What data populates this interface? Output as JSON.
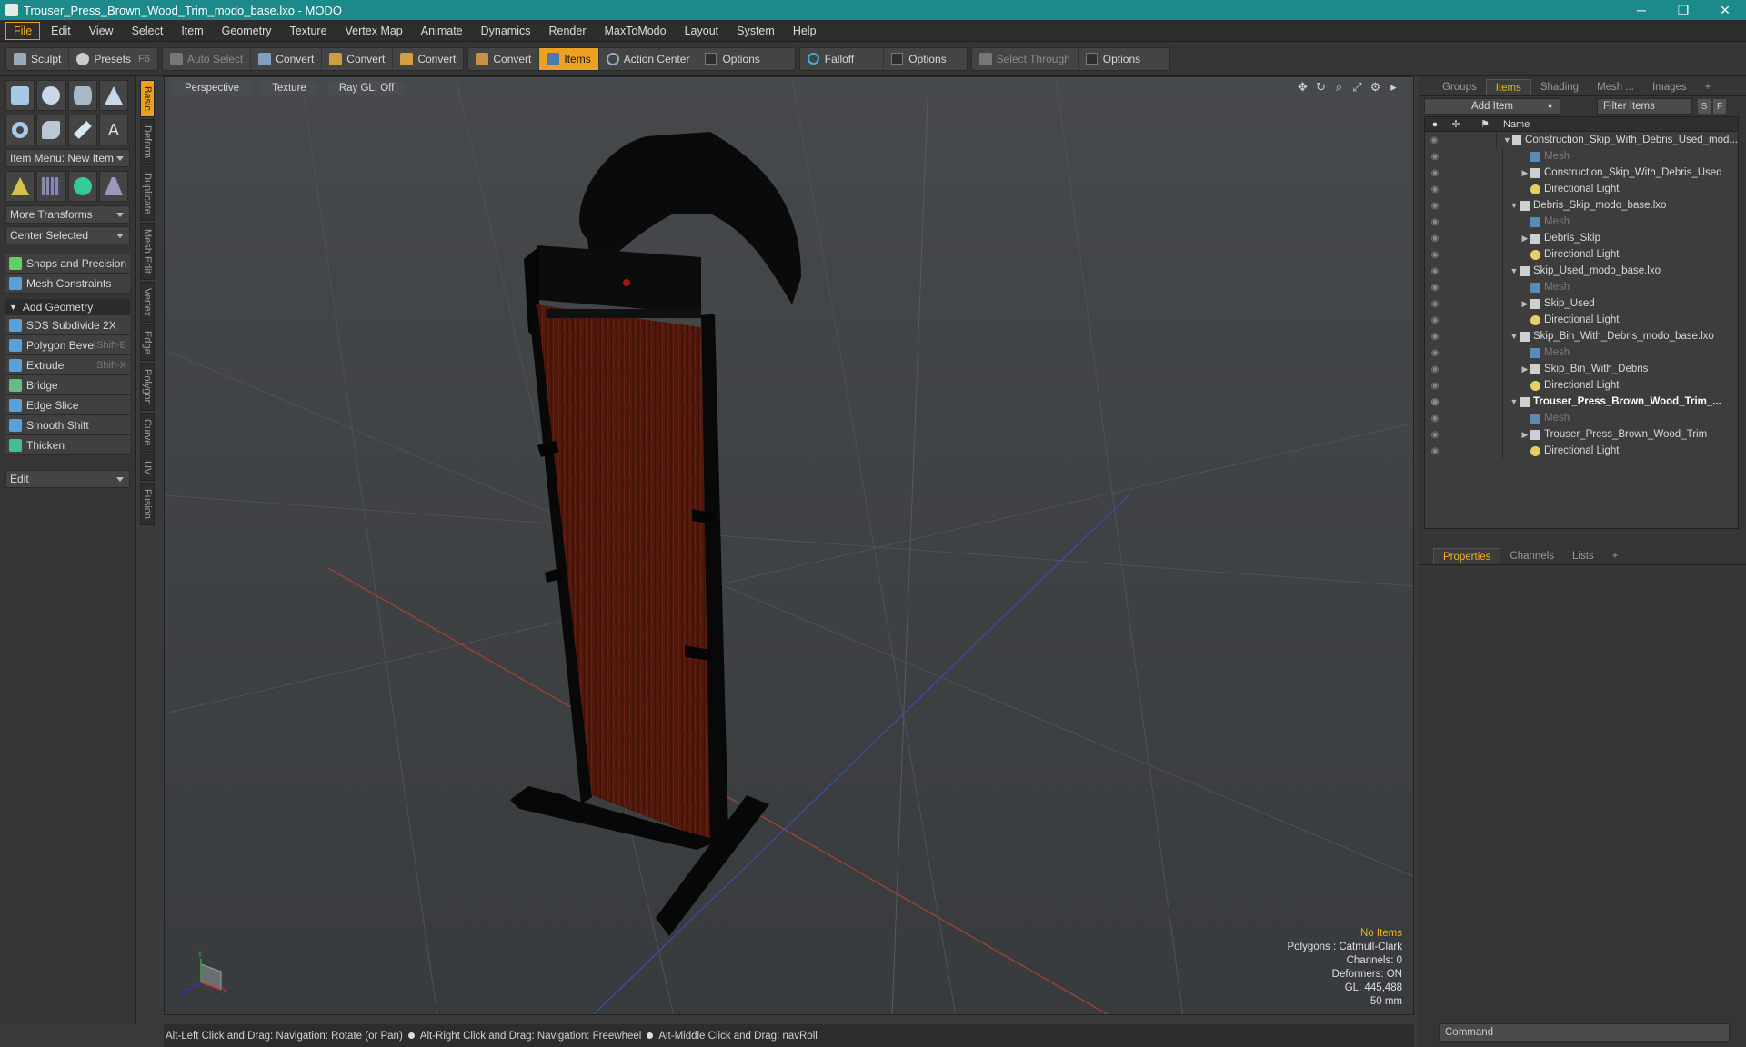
{
  "window": {
    "title": "Trouser_Press_Brown_Wood_Trim_modo_base.lxo - MODO",
    "min_glyph": "─",
    "restore_glyph": "❐",
    "close_glyph": "✕"
  },
  "menu": [
    "File",
    "Edit",
    "View",
    "Select",
    "Item",
    "Geometry",
    "Texture",
    "Vertex Map",
    "Animate",
    "Dynamics",
    "Render",
    "MaxToModo",
    "Layout",
    "System",
    "Help"
  ],
  "toolbar": {
    "sculpt": "Sculpt",
    "presets": "Presets",
    "presets_key": "F6",
    "auto_select": "Auto Select",
    "convert": "Convert",
    "items": "Items",
    "action_center": "Action Center",
    "options": "Options",
    "falloff": "Falloff",
    "select_through": "Select Through"
  },
  "left_panel": {
    "item_menu": "Item Menu: New Item",
    "more_transforms": "More Transforms",
    "center_selected": "Center Selected",
    "snaps": "Snaps and Precision",
    "mesh_constraints": "Mesh Constraints",
    "add_geometry": "Add Geometry",
    "tools": [
      {
        "label": "SDS Subdivide 2X",
        "short": ""
      },
      {
        "label": "Polygon Bevel",
        "short": "Shift-B"
      },
      {
        "label": "Extrude",
        "short": "Shift-X"
      },
      {
        "label": "Bridge",
        "short": ""
      },
      {
        "label": "Edge Slice",
        "short": ""
      },
      {
        "label": "Smooth Shift",
        "short": ""
      },
      {
        "label": "Thicken",
        "short": ""
      }
    ],
    "edit": "Edit",
    "vtabs": [
      "Basic",
      "Deform",
      "Duplicate",
      "Mesh Edit",
      "Vertex",
      "Edge",
      "Polygon",
      "Curve",
      "UV",
      "Fusion"
    ]
  },
  "viewport": {
    "tabs": [
      "Perspective",
      "Texture",
      "Ray GL: Off"
    ],
    "info": {
      "no_items": "No Items",
      "polygons": "Polygons : Catmull-Clark",
      "channels": "Channels: 0",
      "deformers": "Deformers: ON",
      "gl": "GL: 445,488",
      "lens": "50 mm"
    },
    "axis": {
      "x": "X",
      "y": "Y",
      "z": "Z"
    },
    "colors": {
      "wood": "#5a1a10",
      "frame": "#0a0a0a",
      "grid": "#555a5e",
      "x_axis": "#c0392b",
      "z_axis": "#3a4fb0"
    }
  },
  "status": {
    "hint1": "Alt-Left Click and Drag: Navigation: Rotate (or Pan)",
    "hint2": "Alt-Right Click and Drag: Navigation: Freewheel",
    "hint3": "Alt-Middle Click and Drag: navRoll"
  },
  "right_panel": {
    "tabs": [
      "Groups",
      "Items",
      "Shading",
      "Mesh ...",
      "Images"
    ],
    "add_item": "Add Item",
    "filter_items": "Filter Items",
    "s_btn": "S",
    "f_btn": "F",
    "col_name": "Name",
    "tree": [
      {
        "label": "Construction_Skip_With_Debris_Used_mod...",
        "level": 0,
        "type": "scene"
      },
      {
        "label": "Mesh",
        "level": 1,
        "type": "mesh",
        "dim": true
      },
      {
        "label": "Construction_Skip_With_Debris_Used",
        "level": 1,
        "type": "item",
        "arrow": true
      },
      {
        "label": "Directional Light",
        "level": 1,
        "type": "light"
      },
      {
        "label": "Debris_Skip_modo_base.lxo",
        "level": 0,
        "type": "scene"
      },
      {
        "label": "Mesh",
        "level": 1,
        "type": "mesh",
        "dim": true
      },
      {
        "label": "Debris_Skip",
        "level": 1,
        "type": "item",
        "arrow": true
      },
      {
        "label": "Directional Light",
        "level": 1,
        "type": "light"
      },
      {
        "label": "Skip_Used_modo_base.lxo",
        "level": 0,
        "type": "scene"
      },
      {
        "label": "Mesh",
        "level": 1,
        "type": "mesh",
        "dim": true
      },
      {
        "label": "Skip_Used",
        "level": 1,
        "type": "item",
        "arrow": true
      },
      {
        "label": "Directional Light",
        "level": 1,
        "type": "light"
      },
      {
        "label": "Skip_Bin_With_Debris_modo_base.lxo",
        "level": 0,
        "type": "scene"
      },
      {
        "label": "Mesh",
        "level": 1,
        "type": "mesh",
        "dim": true
      },
      {
        "label": "Skip_Bin_With_Debris",
        "level": 1,
        "type": "item",
        "arrow": true
      },
      {
        "label": "Directional Light",
        "level": 1,
        "type": "light"
      },
      {
        "label": "Trouser_Press_Brown_Wood_Trim_...",
        "level": 0,
        "type": "scene",
        "bold": true
      },
      {
        "label": "Mesh",
        "level": 1,
        "type": "mesh",
        "dim": true
      },
      {
        "label": "Trouser_Press_Brown_Wood_Trim",
        "level": 1,
        "type": "item",
        "arrow": true
      },
      {
        "label": "Directional Light",
        "level": 1,
        "type": "light"
      }
    ],
    "props_tabs": [
      "Properties",
      "Channels",
      "Lists"
    ],
    "command_placeholder": "Command"
  }
}
